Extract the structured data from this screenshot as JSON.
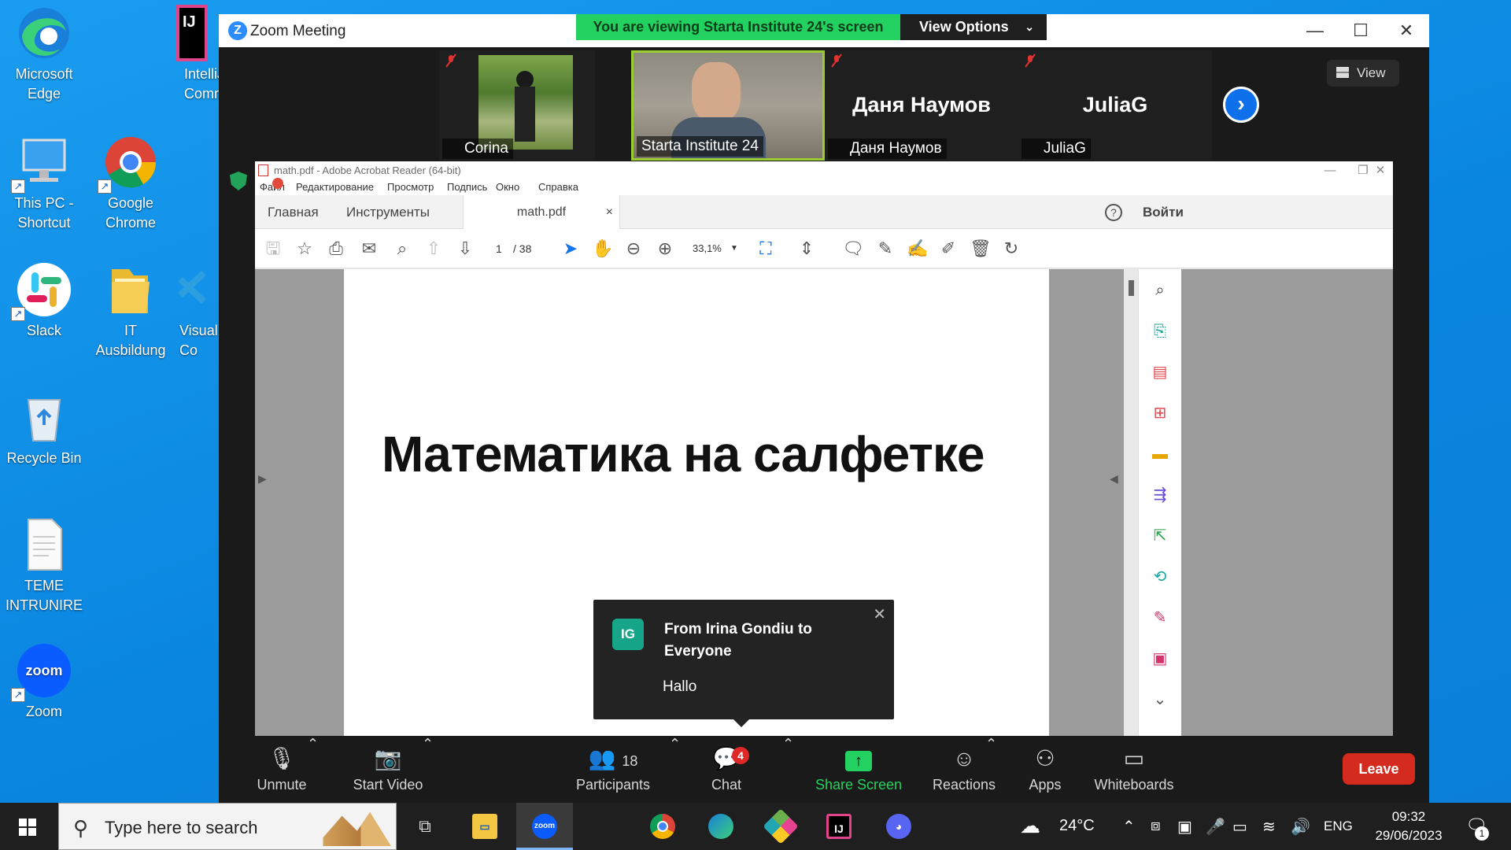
{
  "desktop": {
    "icons": [
      {
        "label": "Microsoft Edge"
      },
      {
        "label": "IntelliJ Comm"
      },
      {
        "label": "This PC - Shortcut"
      },
      {
        "label": "Google Chrome"
      },
      {
        "label": "Slack"
      },
      {
        "label": "IT Ausbildung"
      },
      {
        "label": "Visual Co"
      },
      {
        "label": "Recycle Bin"
      },
      {
        "label": "TEME INTRUNIRE"
      },
      {
        "label": "Zoom"
      }
    ]
  },
  "zoom": {
    "window_title": "Zoom Meeting",
    "banner": "You are viewing Starta Institute 24's screen",
    "view_options": "View Options",
    "view_button": "View",
    "participants": [
      {
        "name": "Corina"
      },
      {
        "name": "Starta Institute 24"
      },
      {
        "name": "Даня Наумов",
        "big": "Даня Наумов"
      },
      {
        "name": "JuliaG",
        "big": "JuliaG"
      }
    ],
    "controls": {
      "unmute": "Unmute",
      "start_video": "Start Video",
      "participants": "Participants",
      "participants_count": "18",
      "chat": "Chat",
      "chat_badge": "4",
      "share_screen": "Share Screen",
      "reactions": "Reactions",
      "apps": "Apps",
      "whiteboards": "Whiteboards",
      "leave": "Leave"
    },
    "chat_popup": {
      "initials": "IG",
      "from": "From Irina Gondiu to Everyone",
      "message": "Hallo"
    }
  },
  "acrobat": {
    "title": "math.pdf - Adobe Acrobat Reader (64-bit)",
    "menu": [
      "Файл",
      "Редактирование",
      "Просмотр",
      "Подпись",
      "Окно",
      "Справка"
    ],
    "tabs": {
      "home": "Главная",
      "tools": "Инструменты",
      "doc": "math.pdf"
    },
    "signin": "Войти",
    "page_current": "1",
    "page_total": "/ 38",
    "zoom": "33,1%",
    "page_heading": "Математика на салфетке"
  },
  "taskbar": {
    "search_placeholder": "Type here to search",
    "weather": "24°C",
    "language": "ENG",
    "time": "09:32",
    "date": "29/06/2023",
    "notification_count": "1"
  }
}
